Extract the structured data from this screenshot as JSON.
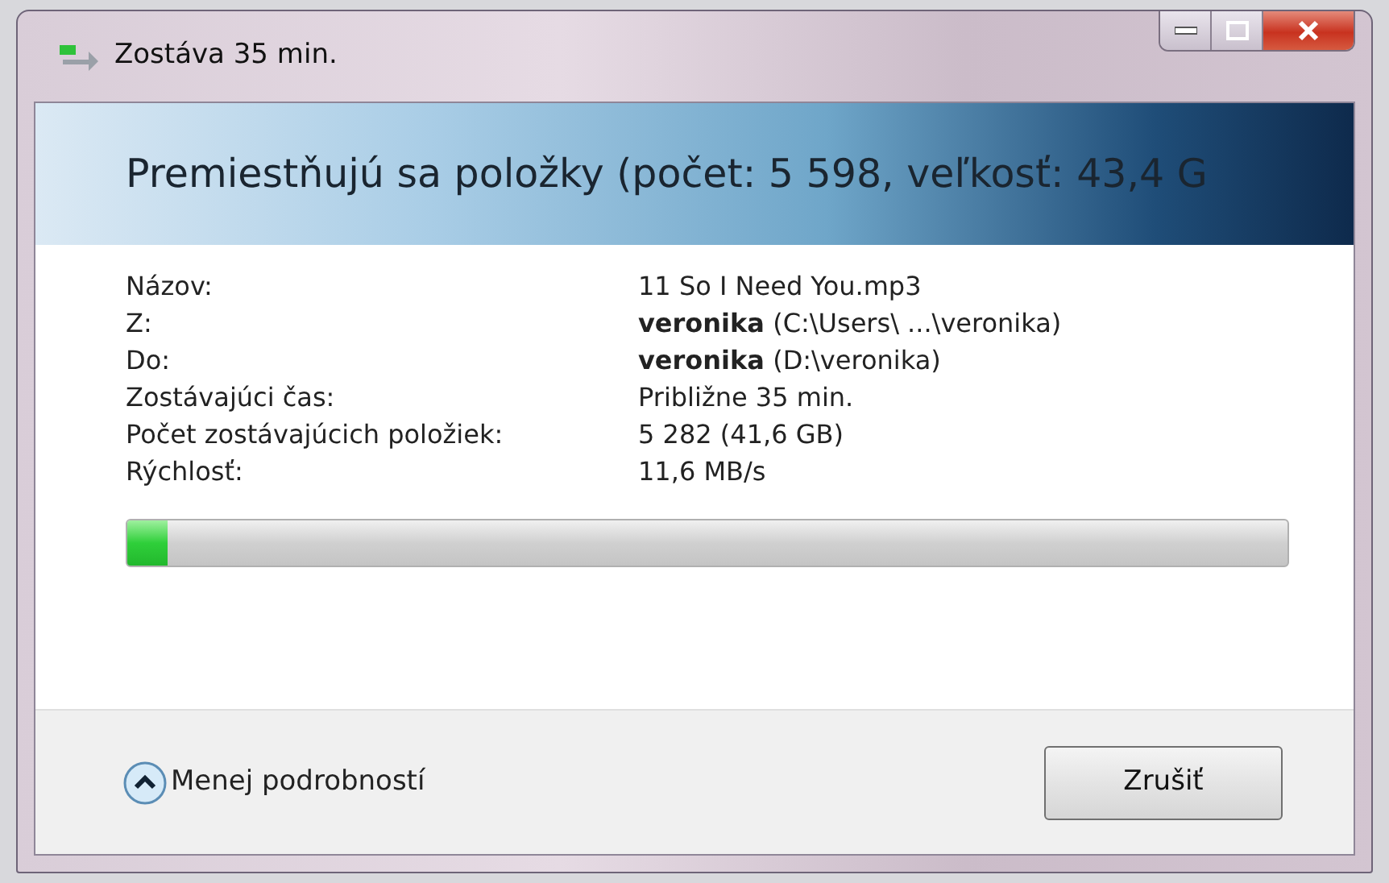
{
  "window": {
    "title": "Zostáva 35 min."
  },
  "header": {
    "title": "Premiestňujú sa položky (počet: 5 598, veľkosť: 43,4 G"
  },
  "details": [
    {
      "label": "Názov:",
      "value": "11 So I Need You.mp3"
    },
    {
      "label": "Z:",
      "value": "**veronika** (C:\\Users\\ ...\\veronika)"
    },
    {
      "label": "Do:",
      "value": "**veronika** (D:\\veronika)"
    },
    {
      "label": "Zostávajúci čas:",
      "value": "Približne 35 min."
    },
    {
      "label": "Počet zostávajúcich položiek:",
      "value": "5 282 (41,6 GB)"
    },
    {
      "label": "Rýchlosť:",
      "value": "11,6 MB/s"
    }
  ],
  "progress": {
    "level": 0.035
  },
  "footer": {
    "details_toggle": {
      "label": "Menej podrobností",
      "expanded": true
    },
    "buttons": [
      "Zrušiť"
    ]
  }
}
